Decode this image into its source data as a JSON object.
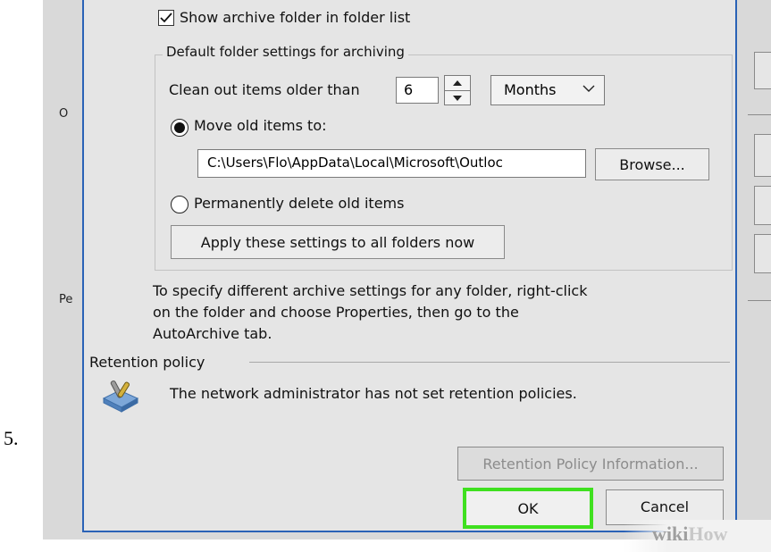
{
  "step_number": "5.",
  "background_window": {
    "labels": [
      "O",
      "Pe"
    ]
  },
  "dialog": {
    "show_archive_folder_label": "Show archive folder in folder list",
    "show_archive_folder_checked": true,
    "group_title": "Default folder settings for archiving",
    "clean_out_label": "Clean out items older than",
    "clean_out_value": "6",
    "period_unit": "Months",
    "move_old_items_label": "Move old items to:",
    "move_old_items_selected": true,
    "archive_path": "C:\\Users\\Flo\\AppData\\Local\\Microsoft\\Outloc",
    "browse_label": "Browse...",
    "delete_items_label": "Permanently delete old items",
    "delete_items_selected": false,
    "apply_all_label": "Apply these settings to all folders now",
    "info_lines": [
      "To specify different archive settings for any folder, right-click",
      "on the folder and choose Properties, then go to the",
      "AutoArchive tab."
    ],
    "retention_section_title": "Retention policy",
    "retention_message": "The network administrator has not set retention policies.",
    "retention_info_label": "Retention Policy Information...",
    "ok_label": "OK",
    "cancel_label": "Cancel"
  },
  "watermark": {
    "part1": "wiki",
    "part2": "How"
  },
  "colors": {
    "dialog_border": "#2a62b6",
    "ok_highlight": "#3fe01f",
    "dialog_background": "#e5e5e5"
  }
}
